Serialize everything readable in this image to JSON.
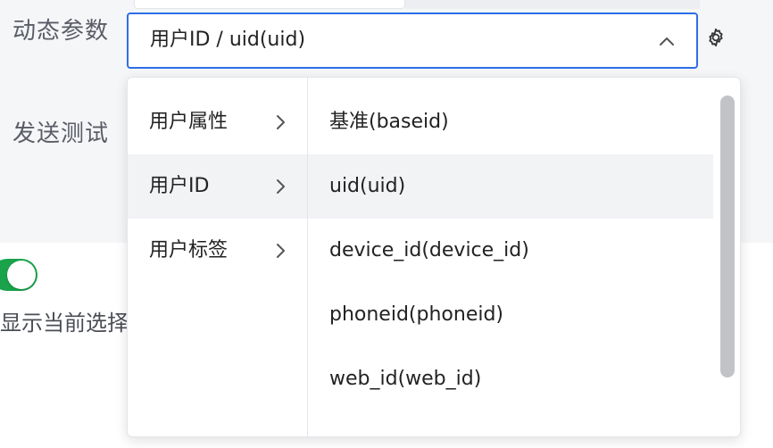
{
  "form": {
    "dynamic_param_label": "动态参数",
    "send_test_label": "发送测试",
    "selected_value": "用户ID / uid(uid)"
  },
  "dropdown": {
    "categories": [
      {
        "label": "用户属性",
        "active": false
      },
      {
        "label": "用户ID",
        "active": true
      },
      {
        "label": "用户标签",
        "active": false
      }
    ],
    "options": [
      {
        "label": "基准(baseid)",
        "active": false
      },
      {
        "label": "uid(uid)",
        "active": true
      },
      {
        "label": "device_id(device_id)",
        "active": false
      },
      {
        "label": "phoneid(phoneid)",
        "active": false
      },
      {
        "label": "web_id(web_id)",
        "active": false
      }
    ]
  },
  "lower": {
    "toggle_on": true,
    "toggle_text": "显示当前选择"
  },
  "colors": {
    "accent": "#2e6ee6",
    "toggle_on": "#1aa34a",
    "active_row": "#f2f3f5"
  },
  "icons": {
    "select_chevron": "chevron-up-icon",
    "settings": "gear-icon",
    "category_arrow": "chevron-right-icon"
  }
}
